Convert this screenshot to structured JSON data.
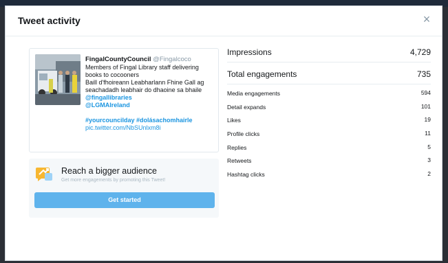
{
  "modal": {
    "title": "Tweet activity",
    "close_glyph": "×"
  },
  "tweet": {
    "author_name": "FingalCountyCouncil",
    "author_handle": "@Fingalcoco",
    "text_lines": [
      "Members of Fingal Library staff delivering",
      "books to cocooners",
      "Baill d'fhoireann Leabharlann Fhine Gall ag",
      "seachadadh leabhair do dhaoine sa bhaile"
    ],
    "mentions": [
      "@fingallibraries",
      "@LGMAIreland"
    ],
    "hashtags": "#yourcouncilday #dolásachomhairle",
    "link": "pic.twitter.com/NbSUnlxm8i"
  },
  "promo": {
    "title": "Reach a bigger audience",
    "subtitle": "Get more engagements by promoting this Tweet!",
    "button_label": "Get started",
    "accent": "#5fb3ec"
  },
  "stats": {
    "impressions": {
      "label": "Impressions",
      "value": "4,729"
    },
    "engagements": {
      "label": "Total engagements",
      "value": "735"
    },
    "breakdown": [
      {
        "label": "Media engagements",
        "value": "594"
      },
      {
        "label": "Detail expands",
        "value": "101"
      },
      {
        "label": "Likes",
        "value": "19"
      },
      {
        "label": "Profile clicks",
        "value": "11"
      },
      {
        "label": "Replies",
        "value": "5"
      },
      {
        "label": "Retweets",
        "value": "3"
      },
      {
        "label": "Hashtag clicks",
        "value": "2"
      }
    ]
  }
}
